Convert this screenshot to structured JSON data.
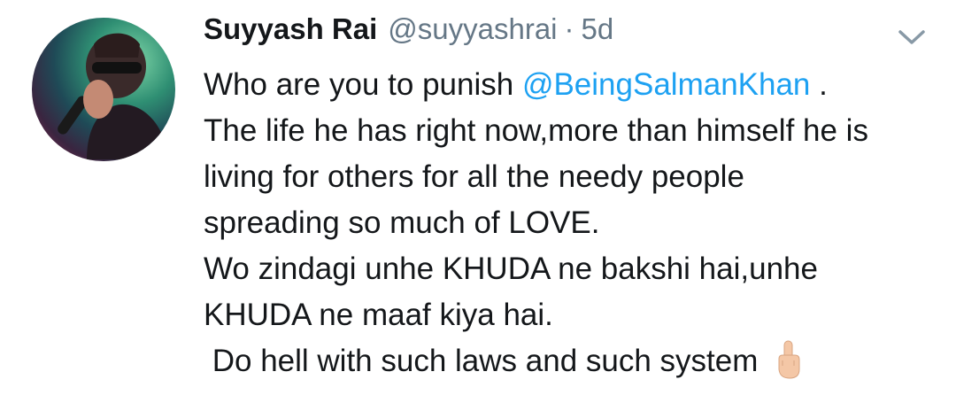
{
  "tweet": {
    "author": {
      "display_name": "Suyyash Rai",
      "handle": "@suyyashrai",
      "separator": "·",
      "timestamp": "5d"
    },
    "menu_icon": "chevron-down-icon",
    "text": {
      "line1_pre": "Who are you to punish ",
      "line1_mention": "@BeingSalmanKhan",
      "line1_post": " .",
      "line2": "The life he has right now,more than himself he is",
      "line3": "living for others for all the needy people",
      "line4": "spreading so much of LOVE.",
      "line5": "Wo zindagi unhe KHUDA ne bakshi hai,unhe",
      "line6": "KHUDA ne maaf kiya hai.",
      "line7": " Do hell with such laws and such system "
    },
    "emoji": "middle-finger-emoji",
    "colors": {
      "text": "#14171a",
      "secondary": "#657786",
      "link": "#1da1f2"
    }
  }
}
